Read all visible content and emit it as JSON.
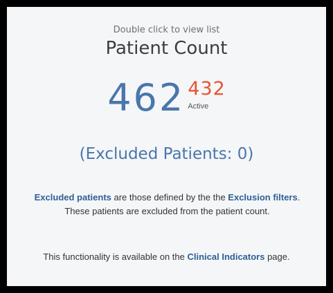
{
  "widget": {
    "hint": "Double click to view list",
    "title": "Patient Count",
    "kpi_main": "462",
    "kpi_secondary": "432",
    "kpi_secondary_label": "Active",
    "excluded": "(Excluded Patients: 0)",
    "description": {
      "bold1": "Excluded patients",
      "text1": " are those defined by the the ",
      "bold2": "Exclusion filters",
      "text2": ". These patients are excluded from the patient count."
    },
    "availability": {
      "text1": "This functionality is available on the ",
      "bold1": "Clinical Indicators",
      "text2": " page."
    }
  },
  "colors": {
    "main_blue": "#4a76aa",
    "accent_orange": "#e8542c",
    "link_blue": "#2e5f95",
    "background": "#f4f6f8",
    "border": "#000000"
  }
}
